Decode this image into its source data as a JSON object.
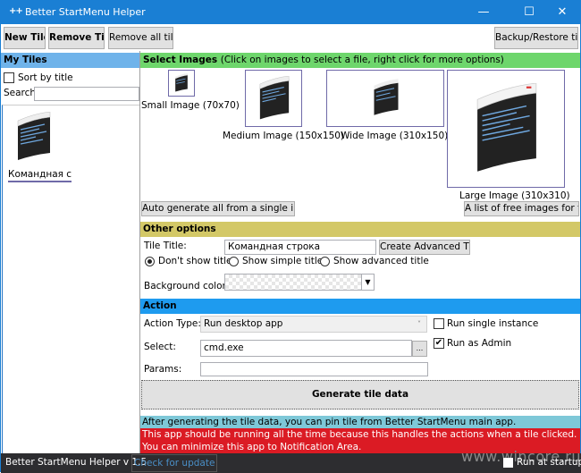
{
  "window": {
    "title": "Better StartMenu Helper",
    "app_icon": "++",
    "controls": {
      "minimize": "—",
      "maximize": "☐",
      "close": "✕"
    }
  },
  "toolbar": {
    "new_tile": "New Tile",
    "remove_tile": "Remove Tile",
    "remove_all": "Remove all tiles",
    "backup_restore": "Backup/Restore tiles"
  },
  "sidebar": {
    "header": "My Tiles",
    "sort_label": "Sort by title",
    "sort_checked": false,
    "search_label": "Search:",
    "search_value": "",
    "tiles": [
      {
        "title": "Командная с"
      }
    ]
  },
  "select_images": {
    "header": "Select Images",
    "header_hint": "(Click on images to select a file, right click for more options)",
    "small_label": "Small Image (70x70)",
    "medium_label": "Medium Image (150x150)",
    "wide_label": "Wide Image (310x150)",
    "large_label": "Large Image (310x310)",
    "auto_generate": "Auto generate all from a single image",
    "free_images": "A list of free images for tiles"
  },
  "other_options": {
    "header": "Other options",
    "tile_title_label": "Tile Title:",
    "tile_title_value": "Командная строка",
    "create_advanced_title": "Create Advanced Title",
    "radio_options": [
      {
        "label": "Don't show title",
        "selected": true
      },
      {
        "label": "Show simple title",
        "selected": false
      },
      {
        "label": "Show advanced title",
        "selected": false
      }
    ],
    "background_color_label": "Background color:",
    "background_color_value": "transparent"
  },
  "action": {
    "header": "Action",
    "action_type_label": "Action Type:",
    "action_type_value": "Run desktop app",
    "select_label": "Select:",
    "select_value": "cmd.exe",
    "browse_button": "...",
    "params_label": "Params:",
    "params_value": "",
    "run_single_instance": {
      "label": "Run single instance",
      "checked": false
    },
    "run_as_admin": {
      "label": "Run as Admin",
      "checked": true
    },
    "generate_button": "Generate tile data"
  },
  "messages": {
    "info": "After generating the tile data, you can pin tile from Better StartMenu main app.",
    "warning": "This app should be running all the time because this handles the actions when a tile clicked. You can minimize this app to Notification Area."
  },
  "statusbar": {
    "version": "Better StartMenu Helper v 1.5",
    "check_update": "Check for update",
    "run_at_startup": {
      "label": "Run at startup",
      "checked": false
    },
    "watermark": "www.wincore.ru"
  },
  "colors": {
    "titlebar": "#1a7fd4",
    "my_tiles_header": "#6fb3ea",
    "select_images_header": "#6ed66c",
    "other_options_header": "#d3c867",
    "action_header": "#1e9bef",
    "info_bar": "#7ec8d8",
    "warning_bar": "#db1b24",
    "statusbar": "#2d2d30"
  }
}
